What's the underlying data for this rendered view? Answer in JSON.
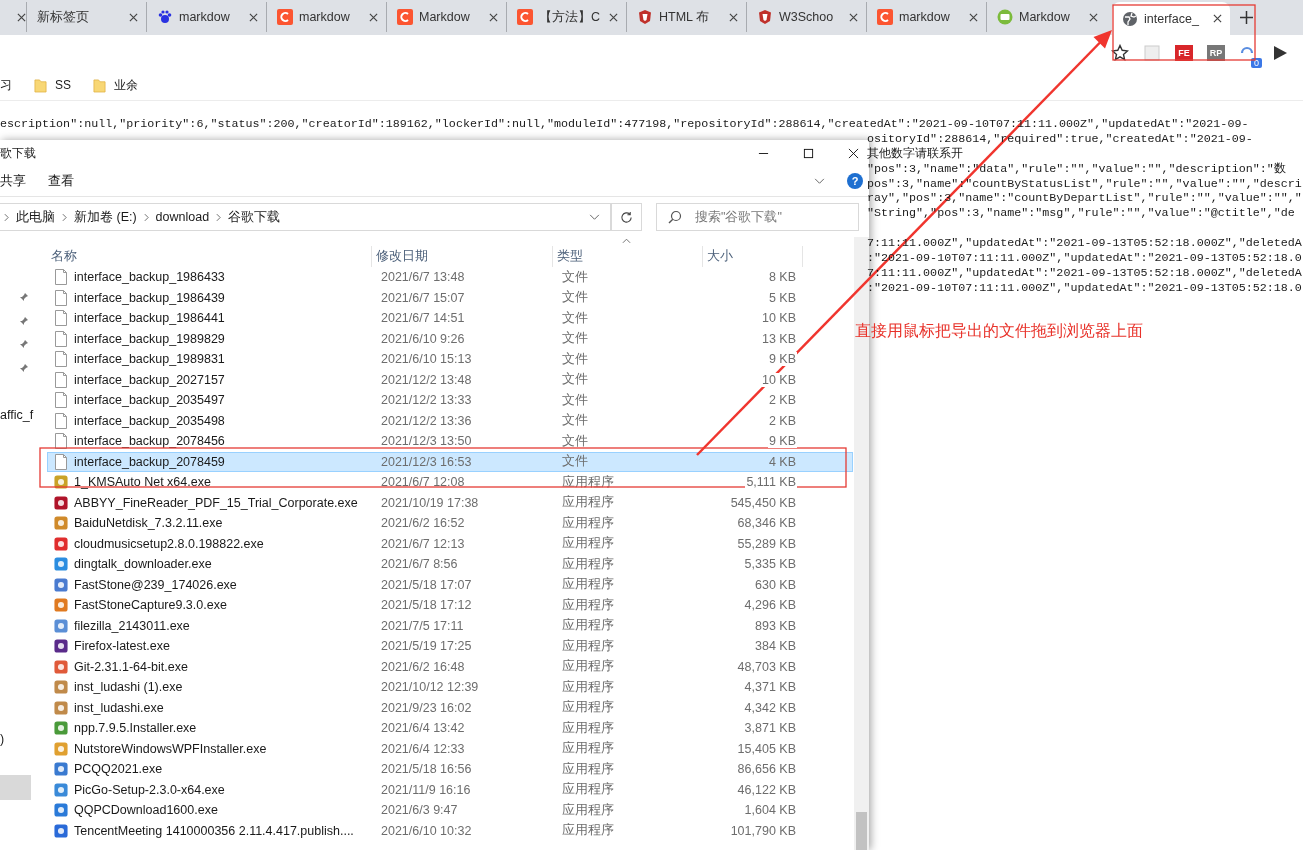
{
  "browser": {
    "tabs": [
      {
        "selected": false
      },
      {
        "title": "新标签页",
        "selected": false
      },
      {
        "title": "markdow",
        "selected": false
      },
      {
        "title": "markdow",
        "selected": false
      },
      {
        "title": "Markdow",
        "selected": false
      },
      {
        "title": "【方法】C",
        "selected": false
      },
      {
        "title": "HTML 布",
        "selected": false
      },
      {
        "title": "W3Schoo",
        "selected": false
      },
      {
        "title": "markdow",
        "selected": false
      },
      {
        "title": "Markdow",
        "selected": false
      },
      {
        "title": "interface_",
        "selected": true
      }
    ],
    "extension_labels": [
      "FE",
      "RP"
    ],
    "extension_badge": "0",
    "bookmarks": [
      {
        "title": "习",
        "folder": false
      },
      {
        "title": "SS",
        "folder": true
      },
      {
        "title": "业余",
        "folder": true
      }
    ]
  },
  "page": {
    "top_line": "escription\":null,\"priority\":6,\"status\":200,\"creatorId\":189162,\"lockerId\":null,\"moduleId\":477198,\"repositoryId\":288614,\"createdAt\":\"2021-09-10T07:11:11.000Z\",\"updatedAt\":\"2021-09-",
    "right_lines": [
      "ositoryId\":288614,\"required\":true,\"createdAt\":\"2021-09-",
      "其他数字请联系开",
      "\"pos\":3,\"name\":\"data\",\"rule\":\"\",\"value\":\"\",\"description\":\"数",
      "pos\":3,\"name\":\"countByStatusList\",\"rule\":\"\",\"value\":\"\",\"descri",
      "ray\",\"pos\":3,\"name\":\"countByDepartList\",\"rule\":\"\",\"value\":\"\",\"",
      "\"String\",\"pos\":3,\"name\":\"msg\",\"rule\":\"\",\"value\":\"@ctitle\",\"de"
    ],
    "lower_lines": [
      "7:11:11.000Z\",\"updatedAt\":\"2021-09-13T05:52:18.000Z\",\"deletedA",
      ":\"2021-09-10T07:11:11.000Z\",\"updatedAt\":\"2021-09-13T05:52:18.0",
      "7:11:11.000Z\",\"updatedAt\":\"2021-09-13T05:52:18.000Z\",\"deletedA",
      ":\"2021-09-10T07:11:11.000Z\",\"updatedAt\":\"2021-09-13T05:52:18.0"
    ]
  },
  "explorer": {
    "title": "歌下载",
    "ribbon_tabs": [
      "共享",
      "查看"
    ],
    "help": "?",
    "breadcrumb": [
      "此电脑",
      "新加卷 (E:)",
      "download",
      "谷歌下载"
    ],
    "search": {
      "placeholder": "搜索\"谷歌下载\""
    },
    "columns": [
      "名称",
      "修改日期",
      "类型",
      "大小"
    ],
    "nav_items": [
      {
        "pinned": true,
        "selected": false
      },
      {
        "pinned": true,
        "selected": false
      },
      {
        "pinned": true,
        "selected": false
      },
      {
        "pinned": true,
        "selected": false
      },
      {
        "text": "affic_f",
        "pinned": false,
        "selected": false
      },
      {
        "text": ")",
        "pinned": false,
        "selected": false
      },
      {
        "pinned": false,
        "selected": true
      }
    ],
    "files": [
      {
        "kind": "document",
        "name": "interface_backup_1986433",
        "date": "2021/6/7 13:48",
        "type": "文件",
        "size": "8 KB",
        "selected": false
      },
      {
        "kind": "document",
        "name": "interface_backup_1986439",
        "date": "2021/6/7 15:07",
        "type": "文件",
        "size": "5 KB",
        "selected": false
      },
      {
        "kind": "document",
        "name": "interface_backup_1986441",
        "date": "2021/6/7 14:51",
        "type": "文件",
        "size": "10 KB",
        "selected": false
      },
      {
        "kind": "document",
        "name": "interface_backup_1989829",
        "date": "2021/6/10 9:26",
        "type": "文件",
        "size": "13 KB",
        "selected": false
      },
      {
        "kind": "document",
        "name": "interface_backup_1989831",
        "date": "2021/6/10 15:13",
        "type": "文件",
        "size": "9 KB",
        "selected": false
      },
      {
        "kind": "document",
        "name": "interface_backup_2027157",
        "date": "2021/12/2 13:48",
        "type": "文件",
        "size": "10 KB",
        "selected": false
      },
      {
        "kind": "document",
        "name": "interface_backup_2035497",
        "date": "2021/12/2 13:33",
        "type": "文件",
        "size": "2 KB",
        "selected": false
      },
      {
        "kind": "document",
        "name": "interface_backup_2035498",
        "date": "2021/12/2 13:36",
        "type": "文件",
        "size": "2 KB",
        "selected": false
      },
      {
        "kind": "document",
        "name": "interface_backup_2078456",
        "date": "2021/12/3 13:50",
        "type": "文件",
        "size": "9 KB",
        "selected": false
      },
      {
        "kind": "document",
        "name": "interface_backup_2078459",
        "date": "2021/12/3 16:53",
        "type": "文件",
        "size": "4 KB",
        "selected": true
      },
      {
        "kind": "program",
        "name": "1_KMSAuto Net x64.exe",
        "date": "2021/6/7 12:08",
        "type": "应用程序",
        "size": "5,111 KB",
        "selected": false
      },
      {
        "kind": "program",
        "name": "ABBYY_FineReader_PDF_15_Trial_Corporate.exe",
        "date": "2021/10/19 17:38",
        "type": "应用程序",
        "size": "545,450 KB",
        "selected": false
      },
      {
        "kind": "program",
        "name": "BaiduNetdisk_7.3.2.11.exe",
        "date": "2021/6/2 16:52",
        "type": "应用程序",
        "size": "68,346 KB",
        "selected": false
      },
      {
        "kind": "program",
        "name": "cloudmusicsetup2.8.0.198822.exe",
        "date": "2021/6/7 12:13",
        "type": "应用程序",
        "size": "55,289 KB",
        "selected": false
      },
      {
        "kind": "program",
        "name": "dingtalk_downloader.exe",
        "date": "2021/6/7 8:56",
        "type": "应用程序",
        "size": "5,335 KB",
        "selected": false
      },
      {
        "kind": "program",
        "name": "FastStone@239_174026.exe",
        "date": "2021/5/18 17:07",
        "type": "应用程序",
        "size": "630 KB",
        "selected": false
      },
      {
        "kind": "program",
        "name": "FastStoneCapture9.3.0.exe",
        "date": "2021/5/18 17:12",
        "type": "应用程序",
        "size": "4,296 KB",
        "selected": false
      },
      {
        "kind": "program",
        "name": "filezilla_2143011.exe",
        "date": "2021/7/5 17:11",
        "type": "应用程序",
        "size": "893 KB",
        "selected": false
      },
      {
        "kind": "program",
        "name": "Firefox-latest.exe",
        "date": "2021/5/19 17:25",
        "type": "应用程序",
        "size": "384 KB",
        "selected": false
      },
      {
        "kind": "program",
        "name": "Git-2.31.1-64-bit.exe",
        "date": "2021/6/2 16:48",
        "type": "应用程序",
        "size": "48,703 KB",
        "selected": false
      },
      {
        "kind": "program",
        "name": "inst_ludashi (1).exe",
        "date": "2021/10/12 12:39",
        "type": "应用程序",
        "size": "4,371 KB",
        "selected": false
      },
      {
        "kind": "program",
        "name": "inst_ludashi.exe",
        "date": "2021/9/23 16:02",
        "type": "应用程序",
        "size": "4,342 KB",
        "selected": false
      },
      {
        "kind": "program",
        "name": "npp.7.9.5.Installer.exe",
        "date": "2021/6/4 13:42",
        "type": "应用程序",
        "size": "3,871 KB",
        "selected": false
      },
      {
        "kind": "program",
        "name": "NutstoreWindowsWPFInstaller.exe",
        "date": "2021/6/4 12:33",
        "type": "应用程序",
        "size": "15,405 KB",
        "selected": false
      },
      {
        "kind": "program",
        "name": "PCQQ2021.exe",
        "date": "2021/5/18 16:56",
        "type": "应用程序",
        "size": "86,656 KB",
        "selected": false
      },
      {
        "kind": "program",
        "name": "PicGo-Setup-2.3.0-x64.exe",
        "date": "2021/11/9 16:16",
        "type": "应用程序",
        "size": "46,122 KB",
        "selected": false
      },
      {
        "kind": "program",
        "name": "QQPCDownload1600.exe",
        "date": "2021/6/3 9:47",
        "type": "应用程序",
        "size": "1,604 KB",
        "selected": false
      },
      {
        "kind": "program",
        "name": "TencentMeeting 1410000356 2.11.4.417.publish....",
        "date": "2021/6/10 10:32",
        "type": "应用程序",
        "size": "101,790 KB",
        "selected": false
      }
    ]
  },
  "annotation": {
    "text": "直接用鼠标把导出的文件拖到浏览器上面"
  }
}
